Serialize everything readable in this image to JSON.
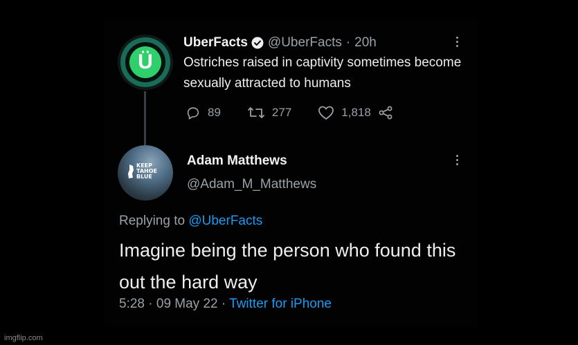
{
  "tweet1": {
    "avatar_letter": "Ü",
    "name": "UberFacts",
    "handle": "@UberFacts",
    "separator": "·",
    "time": "20h",
    "text": "Ostriches raised in captivity sometimes become sexually attracted to humans",
    "replies": "89",
    "retweets": "277",
    "likes": "1,818",
    "icons": [
      "verified-badge-icon",
      "more-options-icon",
      "reply-icon",
      "retweet-icon",
      "like-icon",
      "share-icon"
    ]
  },
  "tweet2": {
    "avatar_badge": [
      "KEEP",
      "TAHOE",
      "BLUE"
    ],
    "name": "Adam Matthews",
    "handle": "@Adam_M_Matthews",
    "replying_prefix": "Replying to",
    "replying_handle": "@UberFacts",
    "text": "Imagine being the person who found this out the hard way",
    "time": "5:28",
    "separator": "·",
    "date": "09 May 22",
    "source": "Twitter for iPhone"
  },
  "watermark": "imgflip.com",
  "colors": {
    "background": "#000000",
    "text": "#e7e9ea",
    "secondary": "#9aa2a8",
    "link": "#1d9bf0",
    "avatar_green": "#2fd06b"
  }
}
